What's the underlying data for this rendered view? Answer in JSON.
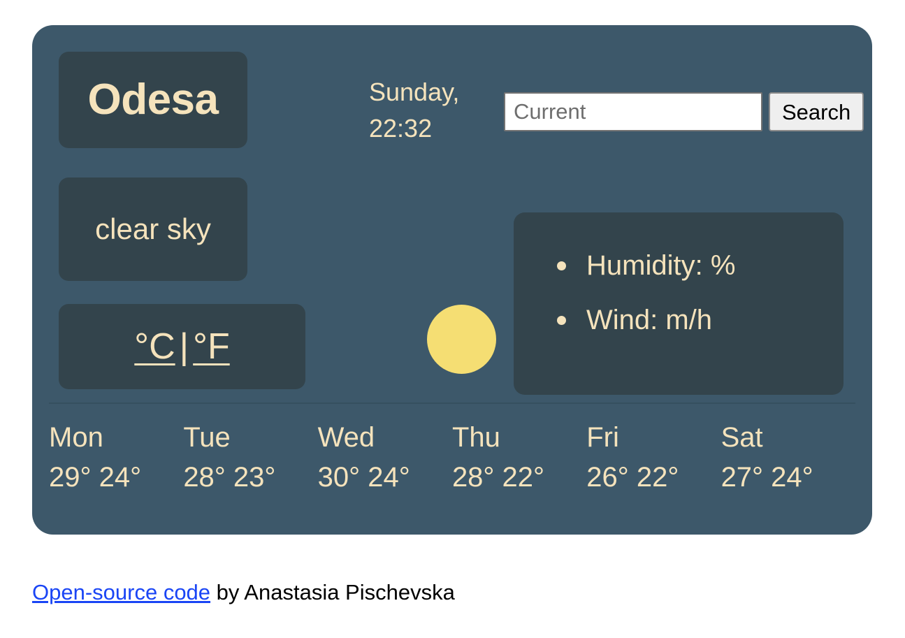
{
  "city": {
    "name": "Odesa"
  },
  "datetime": {
    "day": "Sunday,",
    "time": "22:32"
  },
  "search": {
    "placeholder": "Current",
    "value": "",
    "button_label": "Search"
  },
  "current": {
    "condition": "clear sky",
    "icon": "sun-icon",
    "icon_color": "#f5de73",
    "details": [
      "Humidity: %",
      "Wind: m/h"
    ]
  },
  "units": {
    "celsius_label": "°C",
    "separator": "|",
    "fahrenheit_label": "°F"
  },
  "forecast": [
    {
      "day": "Mon",
      "temps": "29° 24°",
      "high": "29°",
      "low": "24°"
    },
    {
      "day": "Tue",
      "temps": "28° 23°",
      "high": "28°",
      "low": "23°"
    },
    {
      "day": "Wed",
      "temps": "30° 24°",
      "high": "30°",
      "low": "24°"
    },
    {
      "day": "Thu",
      "temps": "28° 22°",
      "high": "28°",
      "low": "22°"
    },
    {
      "day": "Fri",
      "temps": "26° 22°",
      "high": "26°",
      "low": "22°"
    },
    {
      "day": "Sat",
      "temps": "27° 24°",
      "high": "27°",
      "low": "24°"
    }
  ],
  "footer": {
    "link_text": "Open-source code",
    "credit_text": " by Anastasia Pischevska"
  },
  "colors": {
    "panel_background": "#3d586a",
    "card_background": "#33444c",
    "text_cream": "#f5e3bc",
    "sun_yellow": "#f5de73",
    "link_blue": "#1a45f5"
  }
}
